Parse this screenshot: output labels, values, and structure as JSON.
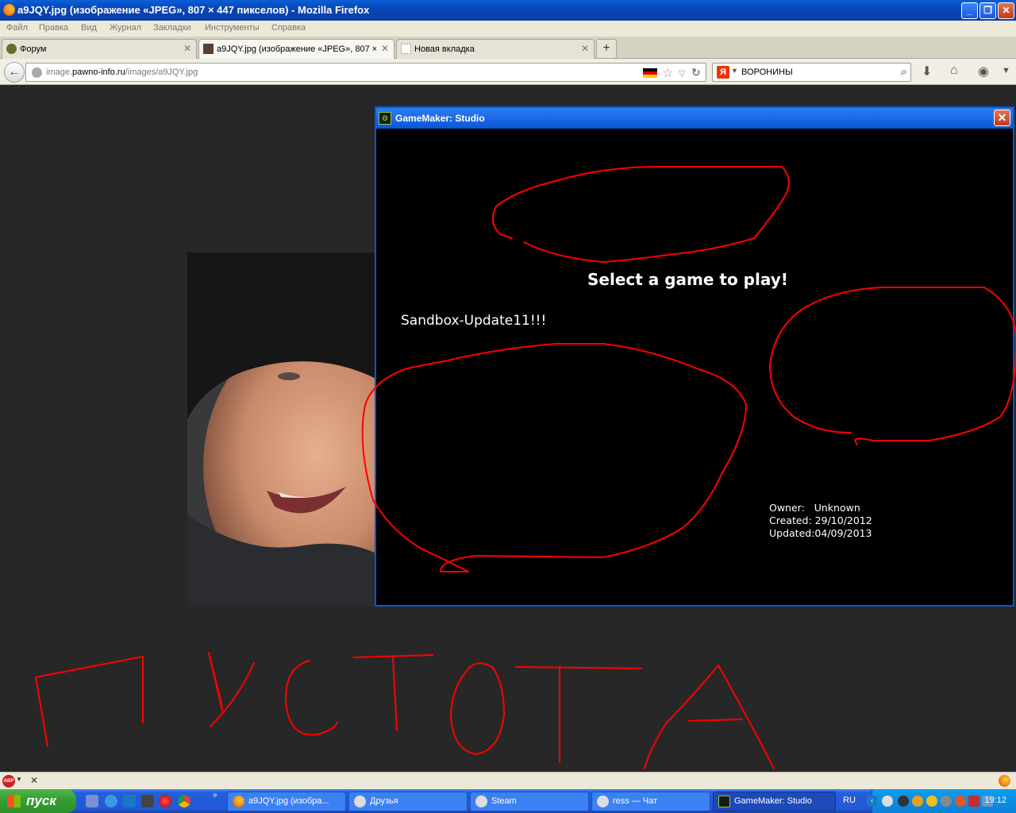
{
  "browser": {
    "window_title": "a9JQY.jpg (изображение «JPEG», 807 × 447 пикселов) - Mozilla Firefox",
    "menu": [
      "Файл",
      "Правка",
      "Вид",
      "Журнал",
      "Закладки",
      "Инструменты",
      "Справка"
    ],
    "tabs": [
      {
        "label": "Форум",
        "active": false
      },
      {
        "label": "a9JQY.jpg (изображение «JPEG», 807 ×",
        "active": true
      },
      {
        "label": "Новая вкладка",
        "active": false
      }
    ],
    "url_domain_prefix": "image.",
    "url_domain": "pawno-info.ru",
    "url_path": "/images/a9JQY.jpg",
    "search_query": "ВОРОНИНЫ"
  },
  "gamemaker": {
    "window_title": "GameMaker: Studio",
    "heading": "Select a game to play!",
    "game_name": "Sandbox-Update11!!!",
    "owner_label": "Owner:",
    "owner_value": "Unknown",
    "created_label": "Created:",
    "created_value": "29/10/2012",
    "updated_label": "Updated:",
    "updated_value": "04/09/2013"
  },
  "addon_bar": {
    "abp_label": "ABP"
  },
  "taskbar": {
    "start_label": "пуск",
    "buttons": [
      {
        "label": "a9JQY.jpg (изобра...",
        "icon": "firefox-icon"
      },
      {
        "label": "Друзья",
        "icon": "steam-icon"
      },
      {
        "label": "Steam",
        "icon": "steam-icon"
      },
      {
        "label": "ress — Чат",
        "icon": "steam-icon"
      },
      {
        "label": "GameMaker: Studio",
        "icon": "gamemaker-icon"
      }
    ],
    "language": "RU",
    "clock": "19:12"
  },
  "colors": {
    "scribble": "#ff0000",
    "xp_blue": "#0a56d8",
    "page_background": "#272727"
  }
}
